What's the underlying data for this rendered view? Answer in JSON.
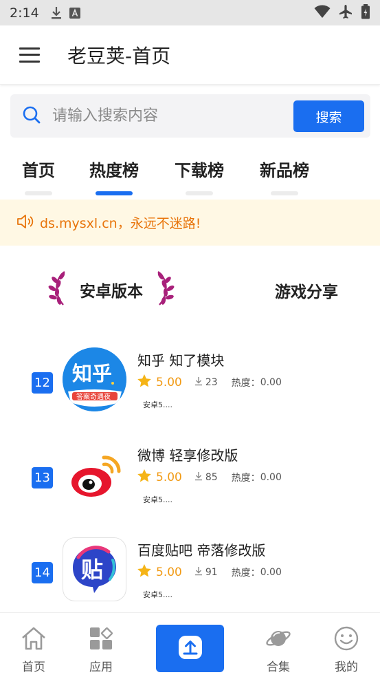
{
  "status_bar": {
    "time": "2:14"
  },
  "app_bar": {
    "title": "老豆荚-首页"
  },
  "search": {
    "placeholder": "请输入搜索内容",
    "button_label": "搜索"
  },
  "tabs": [
    {
      "label": "首页",
      "active": false
    },
    {
      "label": "热度榜",
      "active": true
    },
    {
      "label": "下载榜",
      "active": false
    },
    {
      "label": "新品榜",
      "active": false
    }
  ],
  "notice": {
    "text": "ds.mysxl.cn，永远不迷路!"
  },
  "sections": {
    "left": "安卓版本",
    "right": "游戏分享"
  },
  "apps": [
    {
      "rank": "12",
      "name": "知乎 知了模块",
      "rating": "5.00",
      "downloads": "23",
      "heat_label": "热度：",
      "heat": "0.00",
      "version": "安卓5....",
      "icon_text": "知乎",
      "icon_caption": "答案奇遇夜"
    },
    {
      "rank": "13",
      "name": "微博 轻享修改版",
      "rating": "5.00",
      "downloads": "85",
      "heat_label": "热度：",
      "heat": "0.00",
      "version": "安卓5...."
    },
    {
      "rank": "14",
      "name": "百度贴吧 帝落修改版",
      "rating": "5.00",
      "downloads": "91",
      "heat_label": "热度：",
      "heat": "0.00",
      "version": "安卓5....",
      "icon_text": "贴"
    }
  ],
  "bottom_nav": {
    "home": "首页",
    "apps": "应用",
    "collections": "合集",
    "me": "我的"
  },
  "colors": {
    "accent": "#1a6ef0",
    "notice_bg": "#fff8e4",
    "notice_text": "#e8740a",
    "rating": "#f19a14",
    "laurel": "#a8207a"
  }
}
